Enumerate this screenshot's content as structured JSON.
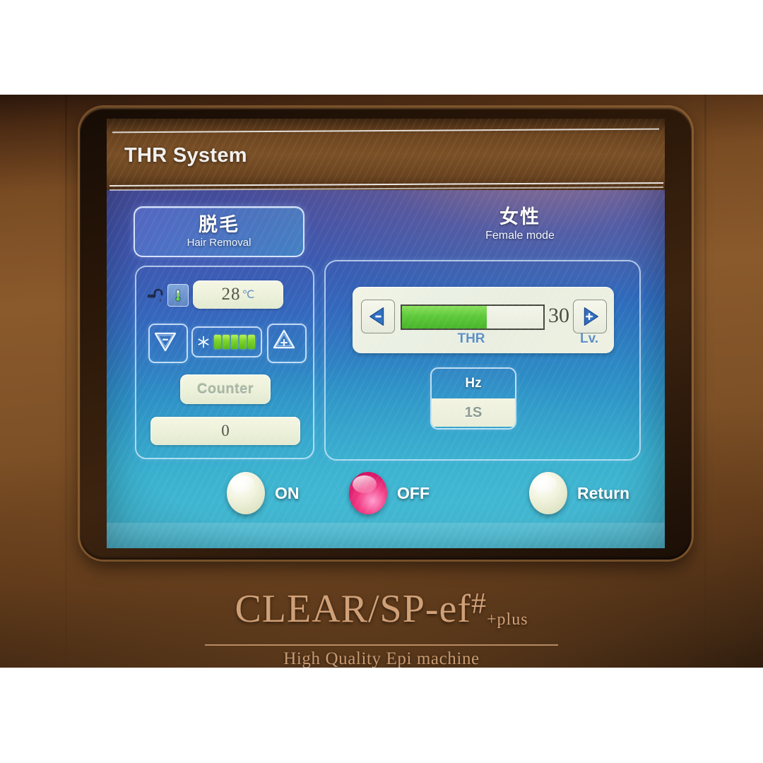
{
  "header": {
    "title": "THR System"
  },
  "mode_button": {
    "jp": "脱毛",
    "en": "Hair Removal",
    "icon": "hair-removal-mode"
  },
  "gender": {
    "jp": "女性",
    "en": "Female mode"
  },
  "left_panel": {
    "tap_icon": "faucet-icon",
    "thermometer_icon": "thermometer-icon",
    "temperature": {
      "value": "28",
      "unit": "℃"
    },
    "cooling": {
      "decrease_icon": "triangle-down-minus-icon",
      "increase_icon": "triangle-up-plus-icon",
      "snowflake_icon": "snowflake-icon",
      "level": 5,
      "max_level": 5
    },
    "counter": {
      "label": "Counter",
      "value": "0"
    }
  },
  "right_panel": {
    "thr": {
      "label": "THR",
      "level_label": "Lv.",
      "value": "30",
      "fill_percent": 60,
      "decrease_icon": "arrow-left-minus-icon",
      "increase_icon": "arrow-right-plus-icon"
    },
    "hz": {
      "label": "Hz",
      "value": "1S"
    }
  },
  "buttons": [
    {
      "label": "ON",
      "state": "inactive",
      "color": "#eef1da"
    },
    {
      "label": "OFF",
      "state": "active",
      "color": "#e8256f"
    },
    {
      "label": "Return",
      "state": "inactive",
      "color": "#eef1da"
    }
  ],
  "branding": {
    "main": "CLEAR/SP-ef",
    "hash": "#",
    "plus": "+plus",
    "subtitle": "High Quality Epi machine"
  },
  "colors": {
    "accent_brown": "#7a5026",
    "lcd_blue": "#2d8fc6",
    "active_pink": "#e8256f",
    "bar_green": "#5ec93a",
    "brand_copper": "#d0a077"
  }
}
